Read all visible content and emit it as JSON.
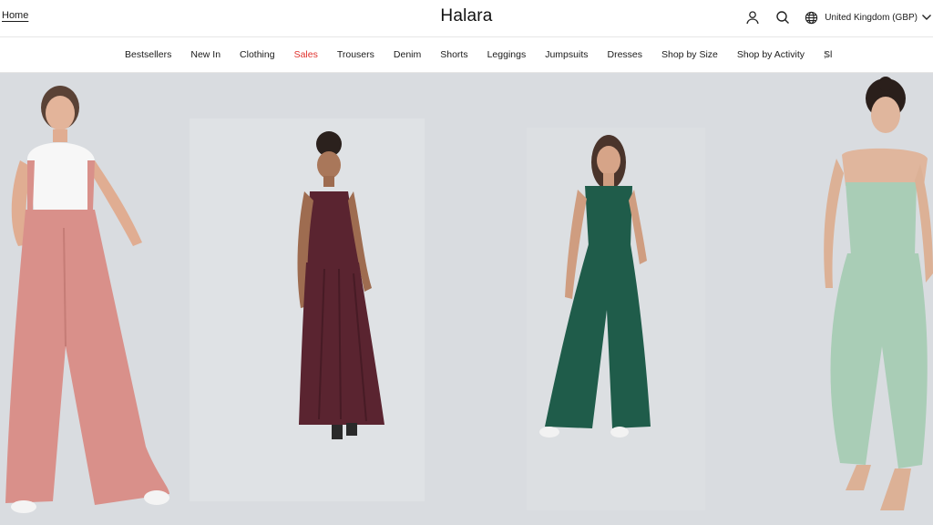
{
  "header": {
    "home_label": "Home",
    "brand": "Halara",
    "region_label": "United Kingdom (GBP)",
    "icons": [
      "user-icon",
      "search-icon",
      "globe-icon",
      "chevron-down-icon"
    ]
  },
  "nav": {
    "items": [
      {
        "label": "Bestsellers"
      },
      {
        "label": "New In"
      },
      {
        "label": "Clothing"
      },
      {
        "label": "Sales",
        "highlight": "#e0322d"
      },
      {
        "label": "Trousers"
      },
      {
        "label": "Denim"
      },
      {
        "label": "Shorts"
      },
      {
        "label": "Leggings"
      },
      {
        "label": "Jumpsuits"
      },
      {
        "label": "Dresses"
      },
      {
        "label": "Shop by Size"
      },
      {
        "label": "Shop by Activity"
      },
      {
        "label": "Sl"
      }
    ],
    "next_icon": "chevron-right-icon"
  },
  "hero": {
    "background": "#d9dce0",
    "products": [
      {
        "name": "pink-wide-leg-overall",
        "color": "#d9908a"
      },
      {
        "name": "burgundy-maxi-dress",
        "color": "#5a2430"
      },
      {
        "name": "green-wide-leg-jumpsuit",
        "color": "#1f5c4a"
      },
      {
        "name": "mint-strapless-harem-jumpsuit",
        "color": "#a9cdb6"
      }
    ]
  }
}
